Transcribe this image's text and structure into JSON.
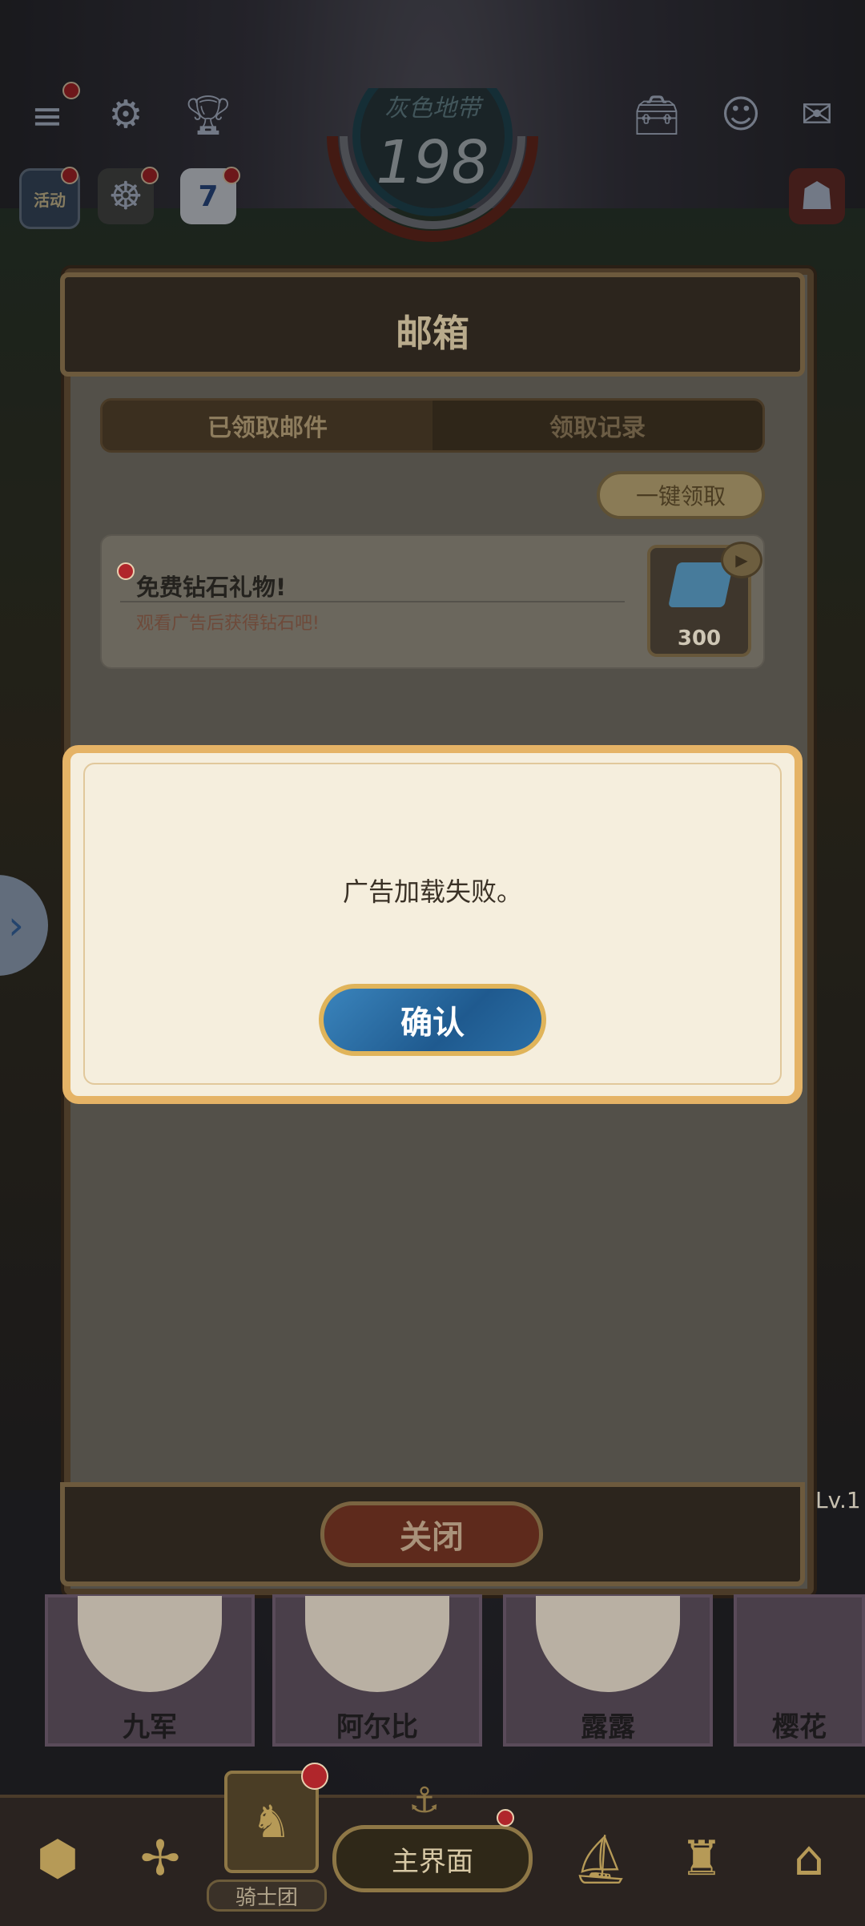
{
  "hud": {
    "area_name": "灰色地带",
    "level": "198",
    "activity_label": "活动",
    "calendar_day": "7"
  },
  "mailbox": {
    "title": "邮箱",
    "tabs": [
      {
        "label": "已领取邮件",
        "active": true
      },
      {
        "label": "领取记录",
        "active": false
      }
    ],
    "claim_all_label": "一键领取",
    "mails": [
      {
        "title": "免费钻石礼物!",
        "description": "观看广告后获得钻石吧!",
        "reward_count": "300",
        "reward_icon": "diamond-icon"
      }
    ],
    "close_label": "关闭"
  },
  "dialog": {
    "message": "广告加载失败。",
    "confirm_label": "确认"
  },
  "characters": [
    {
      "name": "九军"
    },
    {
      "name": "阿尔比"
    },
    {
      "name": "露露"
    },
    {
      "name": "樱花"
    }
  ],
  "character_level": "Lv.1",
  "bottom_nav": {
    "knights_label": "骑士团",
    "main_label": "主界面"
  },
  "colors": {
    "accent_gold": "#e5b366",
    "confirm_blue": "#2a6ea6",
    "alert_red": "#b0262b"
  }
}
